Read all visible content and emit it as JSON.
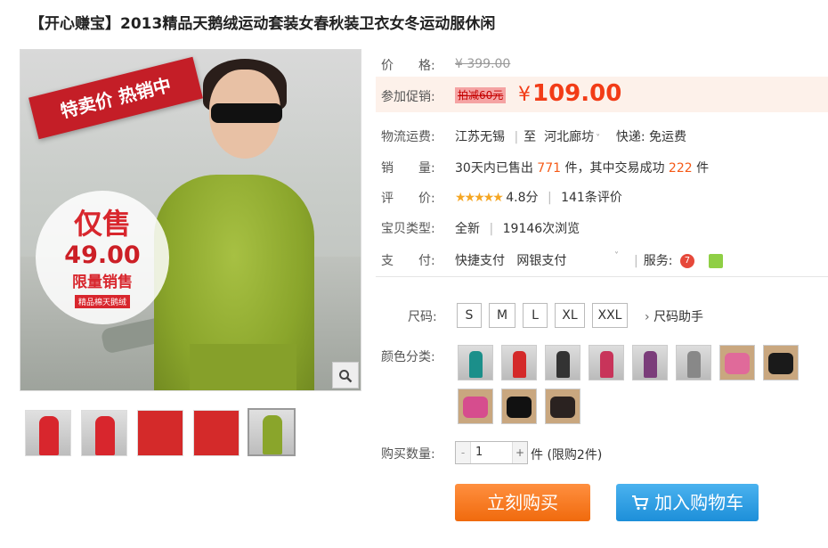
{
  "product": {
    "title": "【开心赚宝】2013精品天鹅绒运动套装女春秋装卫衣女冬运动服休闲"
  },
  "image": {
    "ribbon_text": "特卖价 热销中",
    "circle_line1": "仅售",
    "circle_price": "49.00",
    "circle_line3": "限量销售",
    "circle_line4": "精品棉天鹅绒"
  },
  "price": {
    "label": "价　　格:",
    "original": "¥ 399.00"
  },
  "promo": {
    "label": "参加促销:",
    "tag": "拍减60元",
    "currency": "¥",
    "amount": "109.00"
  },
  "shipping": {
    "label": "物流运费:",
    "from": "江苏无锡",
    "separator": "至",
    "to": "河北廊坊",
    "express": "快递: 免运费"
  },
  "sales": {
    "label": "销　　量:",
    "prefix": "30天内已售出",
    "sold": "771",
    "middle": "件，其中交易成功",
    "success": "222",
    "suffix": "件"
  },
  "rating": {
    "label": "评　　价:",
    "stars": "★★★★★",
    "score": "4.8分",
    "reviews": "141条评价"
  },
  "condition": {
    "label": "宝贝类型:",
    "type": "全新",
    "views": "19146次浏览"
  },
  "payment": {
    "label": "支　　付:",
    "method1": "快捷支付",
    "method2": "网银支付",
    "service_label": "服务:"
  },
  "size": {
    "label": "尺码:",
    "options": [
      "S",
      "M",
      "L",
      "XL",
      "XXL"
    ],
    "helper": "尺码助手"
  },
  "color": {
    "label": "颜色分类:"
  },
  "quantity": {
    "label": "购买数量:",
    "value": "1",
    "minus": "-",
    "plus": "+",
    "unit": "件",
    "limit": "(限购2件)"
  },
  "actions": {
    "buy_now": "立刻购买",
    "add_to_cart": "加入购物车"
  },
  "colors": {
    "promo_price": "#f23c17",
    "buy_button": "#f47a1f",
    "cart_button": "#2a9be3"
  }
}
